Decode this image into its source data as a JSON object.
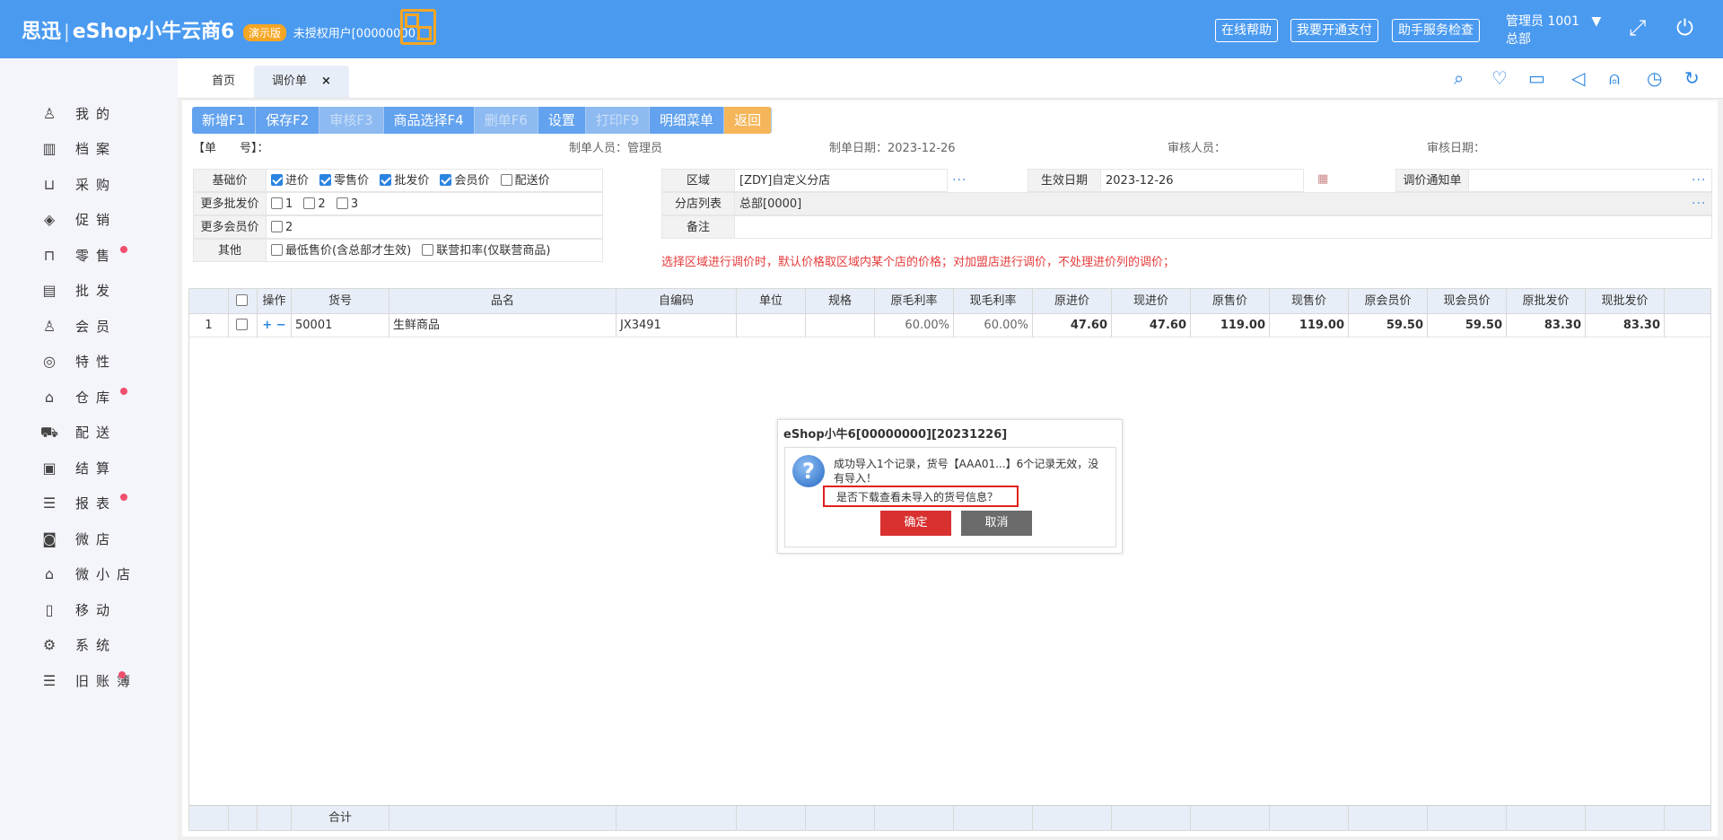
{
  "header": {
    "brand_cn": "思迅",
    "brand_product": "eShop小牛云商6",
    "demo_badge": "演示版",
    "license": "未授权用户[00000000]",
    "buttons": [
      "在线帮助",
      "我要开通支付",
      "助手服务检查"
    ],
    "admin": "管理员 1001",
    "admin_arrow": "▼",
    "branch": "总部"
  },
  "sidebar": {
    "items": [
      {
        "label": "我的",
        "icon": "user-icon",
        "dot": false
      },
      {
        "label": "档案",
        "icon": "archive-icon",
        "dot": false
      },
      {
        "label": "采购",
        "icon": "basket-icon",
        "dot": false
      },
      {
        "label": "促销",
        "icon": "tag-icon",
        "dot": false
      },
      {
        "label": "零售",
        "icon": "bag-icon",
        "dot": true
      },
      {
        "label": "批发",
        "icon": "wholesale-icon",
        "dot": false
      },
      {
        "label": "会员",
        "icon": "member-icon",
        "dot": false
      },
      {
        "label": "特性",
        "icon": "target-icon",
        "dot": false
      },
      {
        "label": "仓库",
        "icon": "warehouse-icon",
        "dot": true
      },
      {
        "label": "配送",
        "icon": "truck-icon",
        "dot": false
      },
      {
        "label": "结算",
        "icon": "settle-icon",
        "dot": false
      },
      {
        "label": "报表",
        "icon": "report-icon",
        "dot": true
      },
      {
        "label": "微店",
        "icon": "shop-icon",
        "dot": false
      },
      {
        "label": "微小店",
        "icon": "store-icon",
        "dot": false
      },
      {
        "label": "移动",
        "icon": "mobile-icon",
        "dot": false
      },
      {
        "label": "系统",
        "icon": "gear-icon",
        "dot": false
      },
      {
        "label": "旧账簿",
        "icon": "ledger-icon",
        "dot": true
      }
    ]
  },
  "tabs": {
    "home": "首页",
    "active": "调价单",
    "close": "×"
  },
  "toolbar": {
    "buttons": [
      {
        "label": "新增F1",
        "enabled": true
      },
      {
        "label": "保存F2",
        "enabled": true
      },
      {
        "label": "审核F3",
        "enabled": false
      },
      {
        "label": "商品选择F4",
        "enabled": true
      },
      {
        "label": "删单F6",
        "enabled": false
      },
      {
        "label": "设置",
        "enabled": true
      },
      {
        "label": "打印F9",
        "enabled": false
      },
      {
        "label": "明细菜单",
        "enabled": true
      },
      {
        "label": "返回",
        "enabled": true
      }
    ]
  },
  "doc_info": {
    "doc_no": "【单　　号】：",
    "creator": "制单人员：管理员",
    "create_date": "制单日期：2023-12-26",
    "auditor": "审核人员：",
    "audit_date": "审核日期："
  },
  "form": {
    "base_price_label": "基础价",
    "base_price_opts": [
      {
        "label": "进价",
        "checked": true
      },
      {
        "label": "零售价",
        "checked": true
      },
      {
        "label": "批发价",
        "checked": true
      },
      {
        "label": "会员价",
        "checked": true
      },
      {
        "label": "配送价",
        "checked": false
      }
    ],
    "more_wholesale_label": "更多批发价",
    "more_wholesale_opts": [
      "1",
      "2",
      "3"
    ],
    "more_member_label": "更多会员价",
    "more_member_opts": [
      "2"
    ],
    "other_label": "其他",
    "other_opts": [
      "最低售价(含总部才生效)",
      "联营扣率(仅联营商品)"
    ],
    "region_label": "区域",
    "region_value": "[ZDY]自定义分店",
    "effective_label": "生效日期",
    "effective_value": "2023-12-26",
    "notice_label": "调价通知单",
    "branches_label": "分店列表",
    "branches_value": "总部[0000]",
    "remark_label": "备注",
    "note": "选择区域进行调价时，默认价格取区域内某个店的价格；对加盟店进行调价，不处理进价列的调价；"
  },
  "grid": {
    "headers": [
      "操作",
      "货号",
      "品名",
      "自编码",
      "单位",
      "规格",
      "原毛利率",
      "现毛利率",
      "原进价",
      "现进价",
      "原售价",
      "现售价",
      "原会员价",
      "现会员价",
      "原批发价",
      "现批发价"
    ],
    "rows": [
      {
        "idx": "1",
        "code": "50001",
        "name": "生鲜商品",
        "selfcode": "JX3491",
        "unit": "",
        "spec": "",
        "old_margin": "60.00%",
        "new_margin": "60.00%",
        "old_cost": "47.60",
        "new_cost": "47.60",
        "old_price": "119.00",
        "new_price": "119.00",
        "old_member": "59.50",
        "new_member": "59.50",
        "old_wholesale": "83.30",
        "new_wholesale": "83.30"
      }
    ],
    "footer_label": "合计"
  },
  "dialog": {
    "title": "eShop小牛6[00000000][20231226]",
    "message": "成功导入1个记录，货号【AAA01...】6个记录无效，没有导入！",
    "question": "是否下载查看未导入的货号信息？",
    "ok": "确定",
    "cancel": "取消"
  },
  "colors": {
    "header_bg": "#4a9af0",
    "accent": "#2a84e0",
    "return_button": "#f5b65a",
    "ok_button": "#d93030",
    "cancel_button": "#6b6b6b"
  }
}
